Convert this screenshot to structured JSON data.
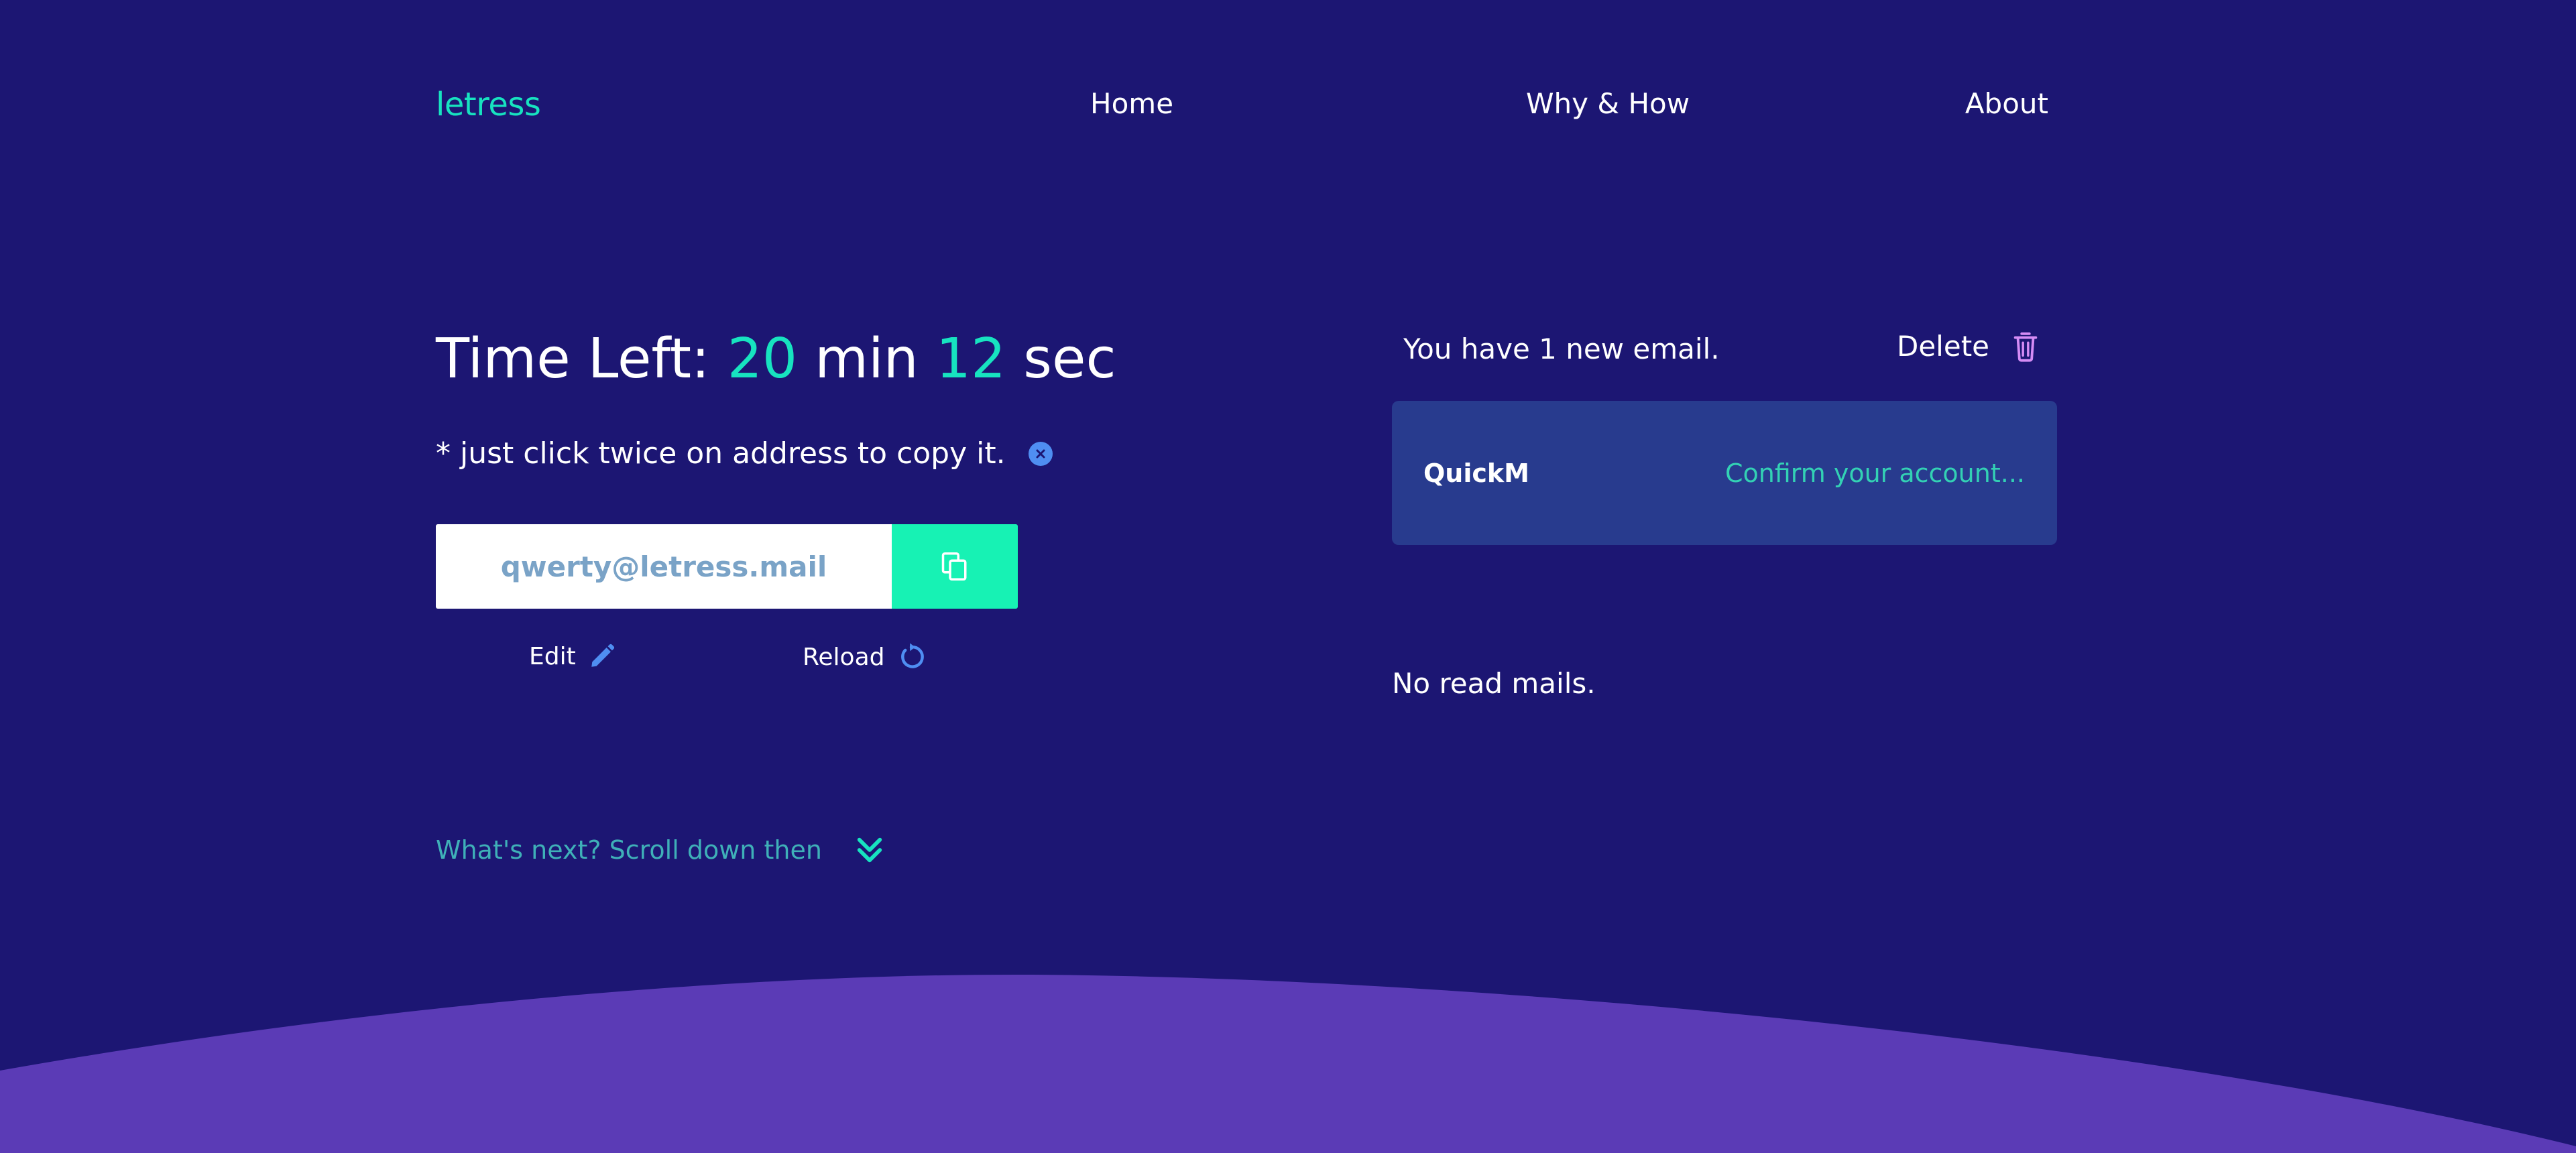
{
  "brand": {
    "logo": "letress"
  },
  "nav": {
    "home": "Home",
    "why_how": "Why & How",
    "about": "About"
  },
  "timer": {
    "prefix": "Time Left:",
    "minutes": "20",
    "min_label": "min",
    "seconds": "12",
    "sec_label": "sec"
  },
  "hint": {
    "text": "* just click twice on address to copy it.",
    "close_icon": "close-circle-icon"
  },
  "address": {
    "value": "qwerty@letress.mail",
    "copy_icon": "copy-icon"
  },
  "actions": {
    "edit_label": "Edit",
    "edit_icon": "pencil-icon",
    "reload_label": "Reload",
    "reload_icon": "reload-icon"
  },
  "scroll_hint": {
    "text": "What's next? Scroll down then",
    "icon": "double-chevron-down-icon"
  },
  "inbox": {
    "status": "You have 1 new email.",
    "delete_label": "Delete",
    "delete_icon": "trash-icon",
    "mails": [
      {
        "sender": "QuickM",
        "subject": "Confirm your account..."
      }
    ],
    "read_status": "No read mails."
  },
  "colors": {
    "background": "#1c1673",
    "accent": "#17e3c0",
    "copy_button": "#17f2b4",
    "mail_card": "#283b8e",
    "wave": "#5b3bb6",
    "icon_blue": "#4f8ef2",
    "trash_icon": "#d58cf5"
  }
}
